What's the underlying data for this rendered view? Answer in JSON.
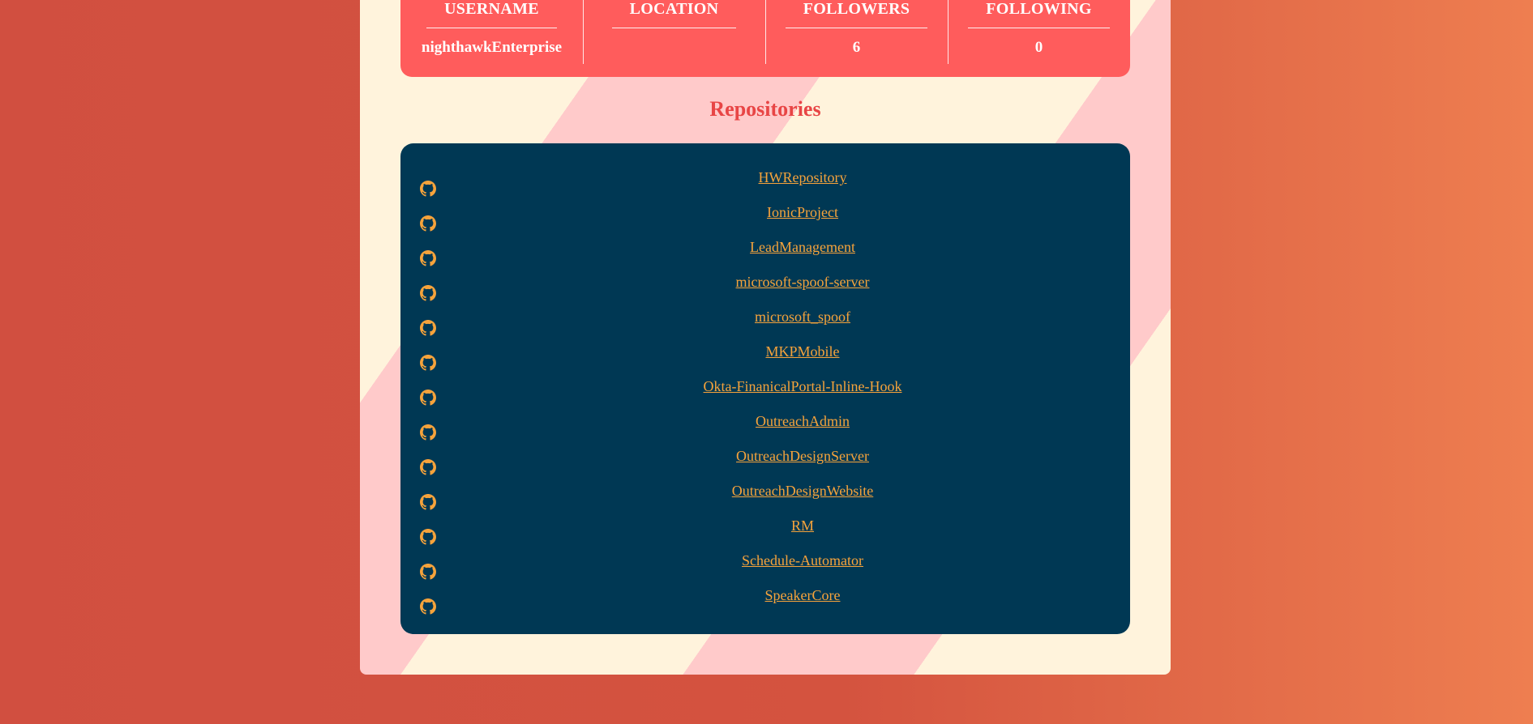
{
  "profile": {
    "stats": [
      {
        "label": "USERNAME",
        "value": "nighthawkEnterprise"
      },
      {
        "label": "LOCATION",
        "value": ""
      },
      {
        "label": "FOLLOWERS",
        "value": "6"
      },
      {
        "label": "FOLLOWING",
        "value": "0"
      }
    ]
  },
  "repositories": {
    "title": "Repositories",
    "icon": "github-icon",
    "items": [
      "HWRepository",
      "IonicProject",
      "LeadManagement",
      "microsoft-spoof-server",
      "microsoft_spoof",
      "MKPMobile",
      "Okta-FinanicalPortal-Inline-Hook",
      "OutreachAdmin",
      "OutreachDesignServer",
      "OutreachDesignWebsite",
      "RM",
      "Schedule-Automator",
      "SpeakerCore"
    ]
  },
  "colors": {
    "background_start": "#d14f40",
    "background_end": "#ee7e50",
    "card_cream": "#fff3dc",
    "card_pink": "#ffcaca",
    "stats_bg": "#ff5c5c",
    "title": "#e84545",
    "panel_bg": "#003854",
    "link": "#f6a33b"
  }
}
